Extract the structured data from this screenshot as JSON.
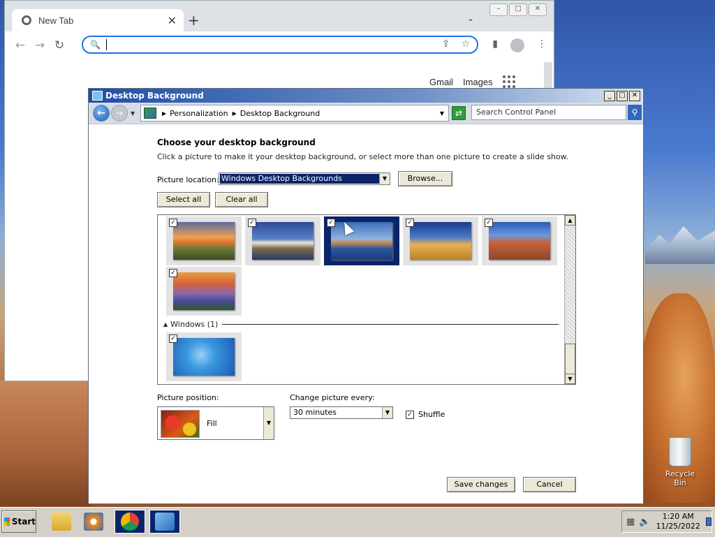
{
  "chrome": {
    "tab_title": "New Tab",
    "tab_close": "✕",
    "new_tab": "+",
    "tab_search": "⌄",
    "google_links": {
      "gmail": "Gmail",
      "images": "Images"
    }
  },
  "cp": {
    "title": "Desktop Background",
    "window_controls": {
      "minimize": "_",
      "maximize": "□",
      "close": "✕"
    },
    "breadcrumb": {
      "personalization": "Personalization",
      "desktop_background": "Desktop Background"
    },
    "search_placeholder": "Search Control Panel",
    "heading": "Choose your desktop background",
    "subtext": "Click a picture to make it your desktop background, or select more than one picture to create a slide show.",
    "picture_location_label": "Picture location:",
    "picture_location_value": "Windows Desktop Backgrounds",
    "browse_label": "Browse...",
    "select_all_label": "Select all",
    "clear_all_label": "Clear all",
    "group_windows": "Windows (1)",
    "thumbnails": [
      {
        "name": "sunset-field",
        "checked": true,
        "selected": false,
        "gradient": "linear-gradient(180deg,#5c6aa0 0%,#f0a050 40%,#d8722c 55%,#6a7a3a 70%,#3d4d22 100%)"
      },
      {
        "name": "lighthouse",
        "checked": true,
        "selected": false,
        "gradient": "linear-gradient(180deg,#2a4a9a 0%,#5a82c8 45%,#e9e6da 55%,#7a6a4a 70%,#2a3a6a 100%)"
      },
      {
        "name": "rock-lake",
        "checked": true,
        "selected": true,
        "gradient": "linear-gradient(180deg,#3d6fb8 0%,#8fb5e0 45%,#c88a4c 55%,#2b5aa0 70%,#1a3a78 100%)"
      },
      {
        "name": "hay-bale",
        "checked": true,
        "selected": false,
        "gradient": "linear-gradient(180deg,#1a3a8a 0%,#4a7ac8 40%,#e8b052 60%,#b8822a 100%)"
      },
      {
        "name": "arch",
        "checked": true,
        "selected": false,
        "gradient": "linear-gradient(180deg,#2a5ab8 0%,#6a9ae0 35%,#c8603a 55%,#8a4a2a 100%)"
      },
      {
        "name": "lupine-lake",
        "checked": true,
        "selected": false,
        "gradient": "linear-gradient(180deg,#e8a040 0%,#d8603a 30%,#8a6aa8 55%,#4a4a9a 75%,#2a5a2a 100%)"
      },
      {
        "name": "windows-default",
        "checked": true,
        "selected": false,
        "gradient": "radial-gradient(circle at 45% 45%,#9ad0f8 0%,#3a98e0 35%,#1a5ab0 100%)"
      }
    ],
    "picture_position_label": "Picture position:",
    "picture_position_value": "Fill",
    "change_picture_label": "Change picture every:",
    "change_picture_value": "30 minutes",
    "shuffle_label": "Shuffle",
    "save_label": "Save changes",
    "cancel_label": "Cancel"
  },
  "desktop": {
    "recycle_bin": "Recycle Bin"
  },
  "taskbar": {
    "start_label": "Start",
    "time": "1:20 AM",
    "date": "11/25/2022"
  }
}
